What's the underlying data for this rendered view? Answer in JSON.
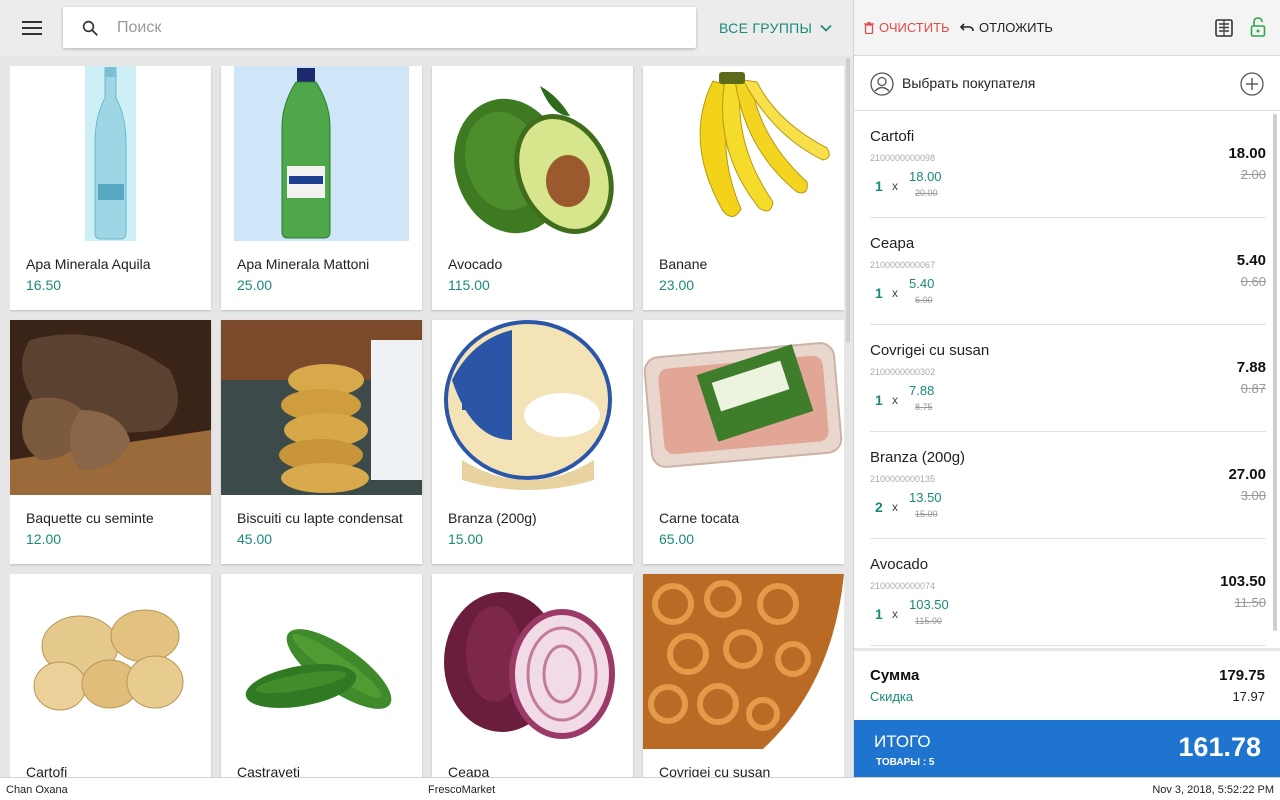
{
  "topbar": {
    "search_placeholder": "Поиск",
    "groups_label": "ВСЕ ГРУППЫ"
  },
  "products": [
    {
      "name": "Apa Minerala Aquila",
      "price": "16.50",
      "image": "water-bottle-aquila"
    },
    {
      "name": "Apa Minerala Mattoni",
      "price": "25.00",
      "image": "water-bottle-mattoni"
    },
    {
      "name": "Avocado",
      "price": "115.00",
      "image": "avocado"
    },
    {
      "name": "Banane",
      "price": "23.00",
      "image": "bananas"
    },
    {
      "name": "Baquette cu seminte",
      "price": "12.00",
      "image": "bread"
    },
    {
      "name": "Biscuiti cu lapte condensat",
      "price": "45.00",
      "image": "cookies-milk"
    },
    {
      "name": "Branza (200g)",
      "price": "15.00",
      "image": "cheese-cup"
    },
    {
      "name": "Carne tocata",
      "price": "65.00",
      "image": "minced-meat-tray"
    },
    {
      "name": "Cartofi",
      "price": "",
      "image": "potatoes"
    },
    {
      "name": "Castraveti",
      "price": "",
      "image": "cucumbers"
    },
    {
      "name": "Ceapa",
      "price": "",
      "image": "onion"
    },
    {
      "name": "Covrigei cu susan",
      "price": "",
      "image": "pretzels"
    }
  ],
  "cart": {
    "clear_label": "ОЧИСТИТЬ",
    "defer_label": "ОТЛОЖИТЬ",
    "customer_label": "Выбрать покупателя",
    "lines": [
      {
        "name": "Cartofi",
        "code": "2100000000098",
        "qty": "1",
        "x": "x",
        "unit_price": "18.00",
        "old_price": "20.00",
        "total": "18.00",
        "discount": "2.00"
      },
      {
        "name": "Ceapa",
        "code": "2100000000067",
        "qty": "1",
        "x": "x",
        "unit_price": "5.40",
        "old_price": "6.00",
        "total": "5.40",
        "discount": "0.60"
      },
      {
        "name": "Covrigei cu susan",
        "code": "2100000000302",
        "qty": "1",
        "x": "x",
        "unit_price": "7.88",
        "old_price": "8.75",
        "total": "7.88",
        "discount": "0.87"
      },
      {
        "name": "Branza (200g)",
        "code": "2100000000135",
        "qty": "2",
        "x": "x",
        "unit_price": "13.50",
        "old_price": "15.00",
        "total": "27.00",
        "discount": "3.00"
      },
      {
        "name": "Avocado",
        "code": "2100000000074",
        "qty": "1",
        "x": "x",
        "unit_price": "103.50",
        "old_price": "115.00",
        "total": "103.50",
        "discount": "11.50"
      }
    ],
    "sum_label": "Сумма",
    "sum_value": "179.75",
    "discount_label": "Скидка",
    "discount_value": "17.97",
    "total_label": "ИТОГО",
    "items_count": "ТОВАРЫ : 5",
    "total_value": "161.78"
  },
  "status": {
    "user": "Chan Oxana",
    "store": "FrescoMarket",
    "datetime": "Nov 3, 2018, 5:52:22 PM"
  },
  "colors": {
    "accent": "#1a8a7a",
    "total_bg": "#1e74cf",
    "danger": "#e04b4b"
  }
}
